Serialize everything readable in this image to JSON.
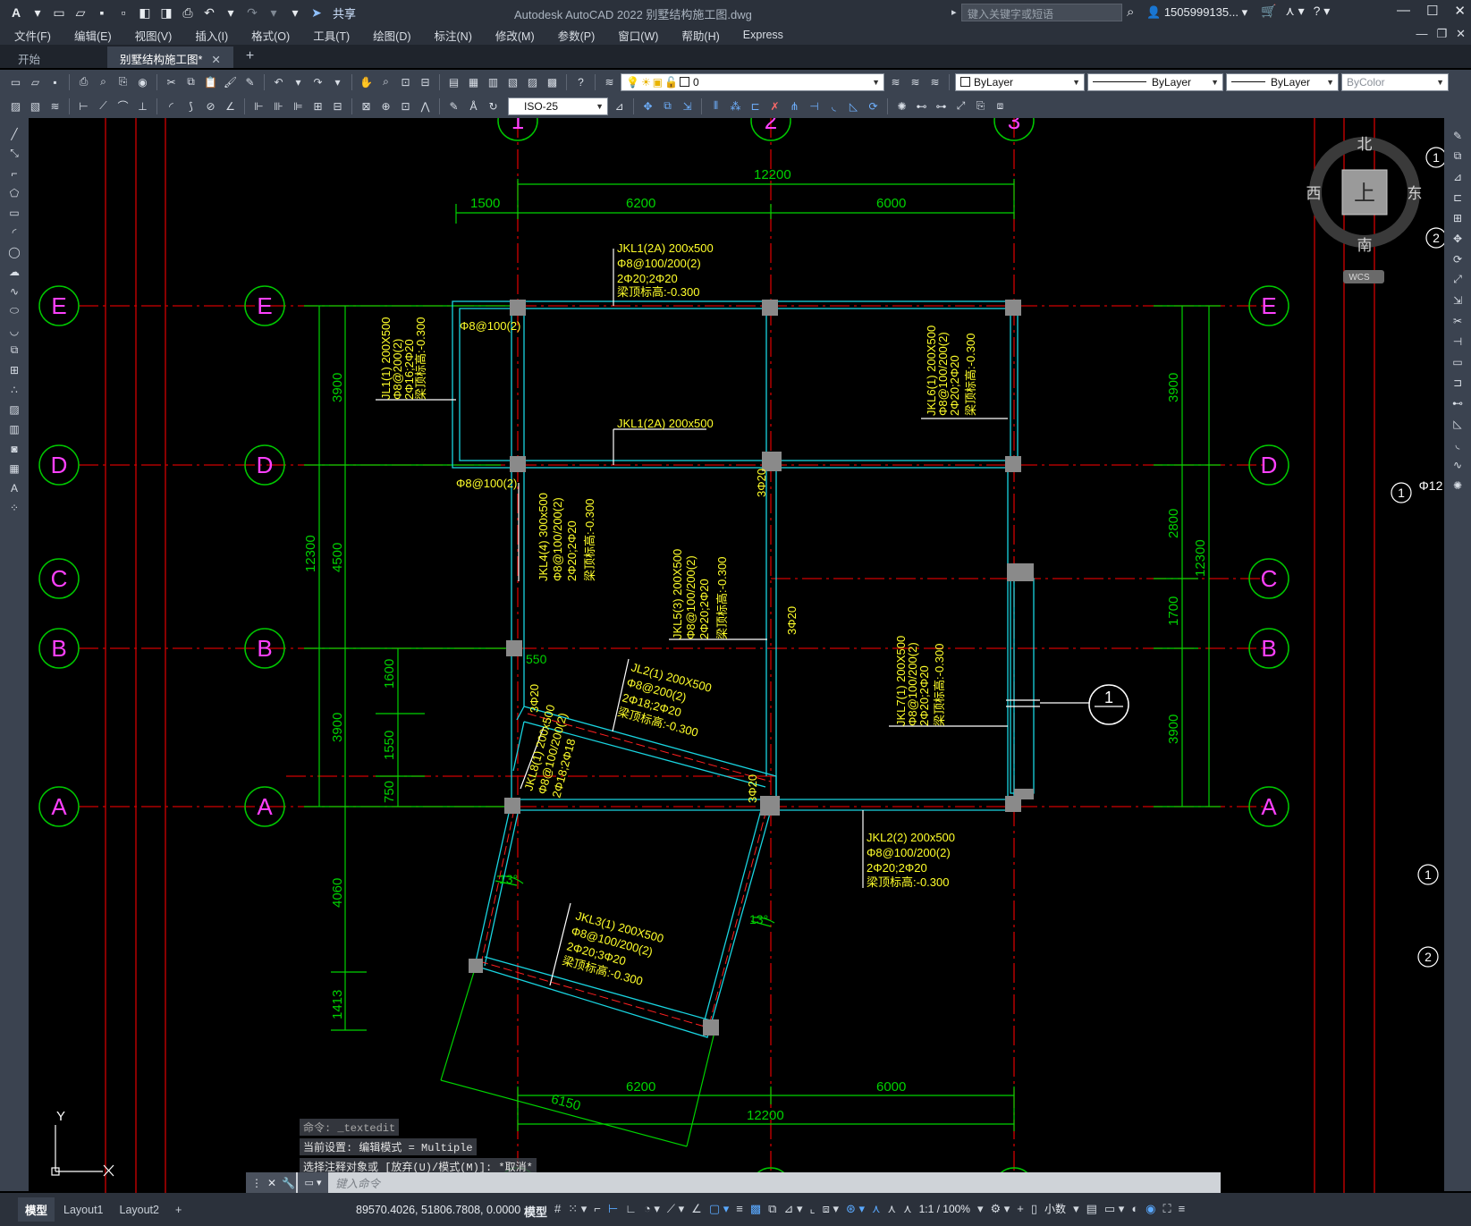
{
  "app": {
    "title": "Autodesk AutoCAD 2022    别墅结构施工图.dwg",
    "logo": "A",
    "share_label": "共享",
    "search_placeholder": "键入关键字或短语",
    "user": "1505999135...",
    "window_controls": [
      "minimize-icon",
      "restore-icon",
      "close-icon"
    ]
  },
  "menu": {
    "items": [
      "文件(F)",
      "编辑(E)",
      "视图(V)",
      "插入(I)",
      "格式(O)",
      "工具(T)",
      "绘图(D)",
      "标注(N)",
      "修改(M)",
      "参数(P)",
      "窗口(W)",
      "帮助(H)",
      "Express"
    ]
  },
  "tabs": {
    "start": "开始",
    "active": "别墅结构施工图*",
    "close": "✕",
    "add": "+"
  },
  "toolbar": {
    "layer_value": "0",
    "color_value": "ByLayer",
    "linetype_value": "ByLayer",
    "lineweight_value": "ByLayer",
    "plotstyle_value": "ByColor",
    "dimstyle_value": "ISO-25"
  },
  "viewcube": {
    "north": "北",
    "south": "南",
    "east": "东",
    "west": "西",
    "top": "上",
    "wcs": "WCS"
  },
  "drawing": {
    "grid_rows": [
      "E",
      "D",
      "C",
      "B",
      "A"
    ],
    "grid_cols": [
      "1",
      "2",
      "3"
    ],
    "dims_top": [
      "12200",
      "1500",
      "6200",
      "6000"
    ],
    "dims_bottom": [
      "6200",
      "6000",
      "12200",
      "6150"
    ],
    "dims_left": [
      "3900",
      "4500",
      "3900",
      "12300",
      "1600",
      "1550",
      "750",
      "4060",
      "1413"
    ],
    "dims_right": [
      "3900",
      "2800",
      "1700",
      "3900",
      "12300"
    ],
    "section_mark": "1",
    "right_edge_labels": [
      "1",
      "2",
      "1",
      "Φ12",
      "1",
      "2"
    ],
    "beams": {
      "jkl1_title": "JKL1(2A) 200x500",
      "jkl1_l2": "Φ8@100/200(2)",
      "jkl1_l3": "2Φ20;2Φ20",
      "jkl1_l4": "梁顶标高:-0.300",
      "jkl1_mid": "JKL1(2A) 200x500",
      "jl1_l1": "JL1(1) 200X500",
      "jl1_l2": "Φ8@200(2)",
      "jl1_l3": "2Φ16;2Φ20",
      "jl1_l4": "梁顶标高:-0.300",
      "stirrup1": "Φ8@100(2)",
      "stirrup2": "Φ8@100(2)",
      "jkl6_l1": "JKL6(1) 200X500",
      "jkl6_l2": "Φ8@100/200(2)",
      "jkl6_l3": "2Φ20;2Φ20",
      "jkl6_l4": "梁顶标高:-0.300",
      "jkl4_l1": "JKL4(4) 300x500",
      "jkl4_l2": "Φ8@100/200(2)",
      "jkl4_l3": "2Φ20;2Φ20",
      "jkl4_l4": "梁顶标高:-0.300",
      "jkl5_l1": "JKL5(3) 200X500",
      "jkl5_l2": "Φ8@100/200(2)",
      "jkl5_l3": "2Φ20;2Φ20",
      "jkl5_l4": "梁顶标高:-0.300",
      "jkl7_l1": "JKL7(1) 200X500",
      "jkl7_l2": "Φ8@100/200(2)",
      "jkl7_l3": "2Φ20;2Φ20",
      "jkl7_l4": "梁顶标高:-0.300",
      "jl2_l1": "JL2(1) 200X500",
      "jl2_l2": "Φ8@200(2)",
      "jl2_l3": "2Φ18;2Φ20",
      "jl2_l4": "梁顶标高:-0.300",
      "jkl8_l1": "JKL8(1) 200x500",
      "jkl8_l2": "Φ8@100/200(2)",
      "jkl8_l3": "2Φ18;2Φ18",
      "jkl2_l1": "JKL2(2) 200x500",
      "jkl2_l2": "Φ8@100/200(2)",
      "jkl2_l3": "2Φ20;2Φ20",
      "jkl2_l4": "梁顶标高:-0.300",
      "jkl3_l1": "JKL3(1) 200X500",
      "jkl3_l2": "Φ8@100/200(2)",
      "jkl3_l3": "2Φ20;3Φ20",
      "jkl3_l4": "梁顶标高:-0.300",
      "bar_3_20": "3Φ20",
      "dim_550": "550",
      "angle": "13°"
    },
    "ucs_y": "Y"
  },
  "command": {
    "history": [
      "命令: _textedit",
      "当前设置: 编辑模式 = Multiple",
      "选择注释对象或 [放弃(U)/模式(M)]: *取消*"
    ],
    "placeholder": "键入命令"
  },
  "status": {
    "tabs": [
      "模型",
      "Layout1",
      "Layout2"
    ],
    "add": "+",
    "coords": "89570.4026, 51806.7808, 0.0000",
    "model": "模型",
    "scale": "1:1 / 100%",
    "units": "小数"
  }
}
